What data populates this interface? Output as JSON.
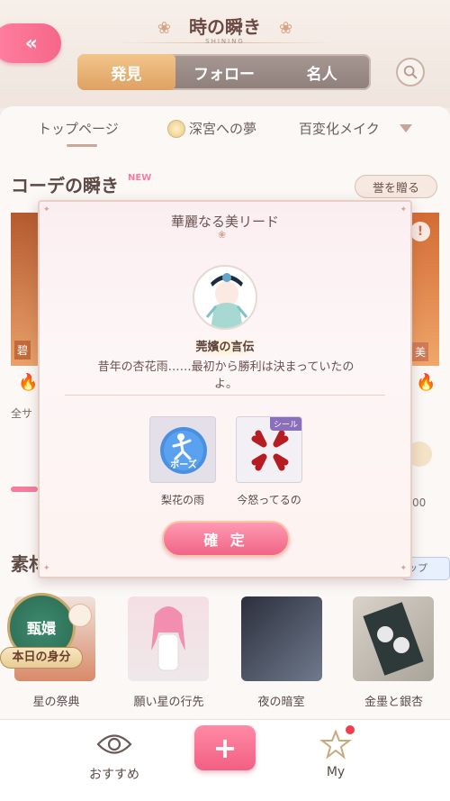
{
  "header": {
    "title": "時の瞬き",
    "subtitle": "SHINING",
    "tabs": [
      {
        "label": "発見",
        "active": true
      },
      {
        "label": "フォロー",
        "active": false
      },
      {
        "label": "名人",
        "active": false
      }
    ]
  },
  "subtabs": [
    "トップページ",
    "深宮への夢",
    "百変化メイク"
  ],
  "section1": {
    "title": "コーデの瞬き",
    "new_badge": "NEW",
    "give_button": "誉を贈る",
    "left_card_label": "碧",
    "right_card_label": "美",
    "side_text": "全サ",
    "right_number": "00"
  },
  "section2": {
    "title": "素材",
    "tag_right": "ップ"
  },
  "badge": {
    "title": "甄嬛",
    "label": "本日の身分"
  },
  "materials": [
    {
      "label": "星の祭典"
    },
    {
      "label": "願い星の行先"
    },
    {
      "label": "夜の暗室"
    },
    {
      "label": "金墨と銀杏"
    }
  ],
  "bottom_nav": {
    "recommend": "おすすめ",
    "plus": "+",
    "my": "My"
  },
  "modal": {
    "title": "華麗なる美リード",
    "name": "莞嬪の言伝",
    "quote": "昔年の杏花雨……最初から勝利は決まっていたのよ。",
    "rewards": [
      {
        "label": "梨花の雨",
        "icon_text": "ポーズ"
      },
      {
        "label": "今怒ってるの",
        "tag": "シール"
      }
    ],
    "confirm": "確 定"
  },
  "colors": {
    "accent_pink": "#f56789",
    "gold": "#dfa163",
    "brown_text": "#5a4a46"
  }
}
